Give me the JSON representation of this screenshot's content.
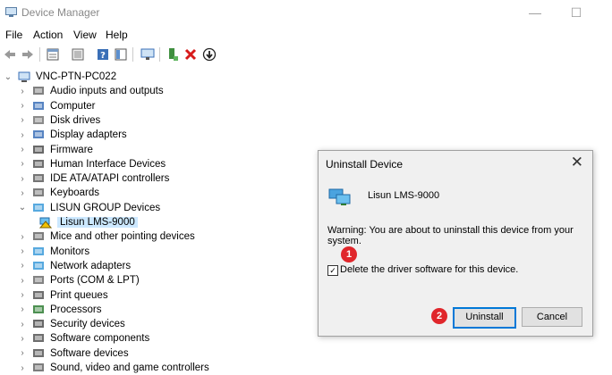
{
  "window": {
    "title": "Device Manager",
    "minimize_glyph": "—",
    "maximize_glyph": "☐"
  },
  "menu": [
    "File",
    "Action",
    "View",
    "Help"
  ],
  "toolbar": {
    "icons": [
      "back-arrow-icon",
      "forward-arrow-icon",
      "properties-icon",
      "update-driver-icon",
      "help-icon",
      "view-icon",
      "monitor-scan-icon",
      "add-driver-icon",
      "uninstall-x-icon",
      "disable-device-icon"
    ]
  },
  "tree": {
    "root": "VNC-PTN-PC022",
    "items": [
      {
        "label": "Audio inputs and outputs",
        "icon": "speaker-icon"
      },
      {
        "label": "Computer",
        "icon": "computer-icon"
      },
      {
        "label": "Disk drives",
        "icon": "disk-icon"
      },
      {
        "label": "Display adapters",
        "icon": "display-icon"
      },
      {
        "label": "Firmware",
        "icon": "firmware-icon"
      },
      {
        "label": "Human Interface Devices",
        "icon": "hid-icon"
      },
      {
        "label": "IDE ATA/ATAPI controllers",
        "icon": "ide-icon"
      },
      {
        "label": "Keyboards",
        "icon": "keyboard-icon"
      },
      {
        "label": "LISUN GROUP Devices",
        "icon": "network-icon",
        "expanded": true
      },
      {
        "label": "Lisun LMS-9000",
        "icon": "warning-device-icon",
        "child": true
      },
      {
        "label": "Mice and other pointing devices",
        "icon": "mouse-icon"
      },
      {
        "label": "Monitors",
        "icon": "monitor-icon"
      },
      {
        "label": "Network adapters",
        "icon": "network-icon"
      },
      {
        "label": "Ports (COM & LPT)",
        "icon": "port-icon"
      },
      {
        "label": "Print queues",
        "icon": "printer-icon"
      },
      {
        "label": "Processors",
        "icon": "processor-icon"
      },
      {
        "label": "Security devices",
        "icon": "security-icon"
      },
      {
        "label": "Software components",
        "icon": "software-component-icon"
      },
      {
        "label": "Software devices",
        "icon": "software-device-icon"
      },
      {
        "label": "Sound, video and game controllers",
        "icon": "sound-icon"
      }
    ]
  },
  "dialog": {
    "title": "Uninstall Device",
    "device_name": "Lisun LMS-9000",
    "warning": "Warning: You are about to uninstall this device from your system.",
    "checkbox_label": "Delete the driver software for this device.",
    "checkbox_checked": true,
    "uninstall_label": "Uninstall",
    "cancel_label": "Cancel"
  },
  "annotations": [
    "1",
    "2"
  ],
  "colors": {
    "accent": "#0078d7",
    "badge": "#e0262b",
    "selection": "#cce8ff"
  }
}
